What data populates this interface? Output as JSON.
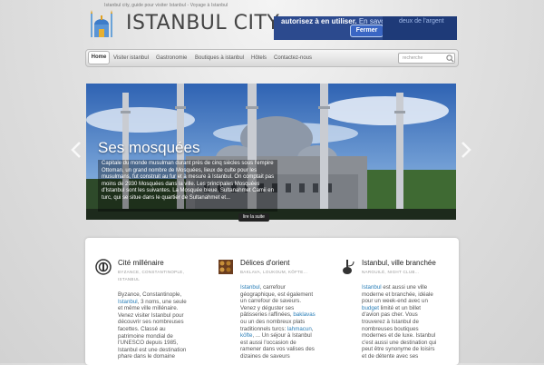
{
  "header": {
    "tagline": "Istanbul city, guide pour visiter Istanbul - Voyage à Istanbul",
    "logo_text": "ISTANBUL CITY"
  },
  "cookie_banner": {
    "text": "autorisez à en utiliser.",
    "more_label": "En savoir plus.",
    "close_label": "Fermer",
    "side_text": "deux de l'argent"
  },
  "nav": {
    "items": [
      "Home",
      "Visiter istanbul",
      "Gastronomie",
      "Boutiques à istanbul",
      "Hôtels",
      "Contactez-nous"
    ],
    "search_placeholder": "recherche"
  },
  "slider": {
    "title": "Ses mosquées",
    "text": "Capitale du monde musulman durant près de cinq siècles sous l'empire Ottoman, un grand nombre de Mosquées, lieux de culte pour les musulmans, fut construit au fur et à mesure à Istanbul. On comptait pas moins de 2930 Mosquées dans la ville. Les principales Mosquées d'Istanbul sont les suivantes. La Mosquée bleue, Sultanahmet Camii en turc, qui se situe dans le quartier de Sultanahmet et...",
    "more_label": "lire la suite"
  },
  "columns": [
    {
      "title": "Cité millénaire",
      "sub": "BYZANCE, CONSTANTINOPLE, ISTANBUL",
      "text_parts": [
        {
          "t": "Byzance, Constantinople, "
        },
        {
          "t": "Istanbul",
          "link": true
        },
        {
          "t": ", 3 noms, une seule et même ville millénaire. Venez visiter Istanbul pour découvrir ses nombreuses facettes. Classé au patrimoine mondial de l'UNESCO depuis 1985, Istanbul est une destination phare dans le domaine"
        }
      ]
    },
    {
      "title": "Délices d'orient",
      "sub": "BAKLAVA, LOUKOUM, KÖFTE...",
      "text_parts": [
        {
          "t": "Istanbul",
          "link": true
        },
        {
          "t": ", carrefour géographique, est également un carrefour de saveurs. Venez y déguster ses pâtisseries raffinées, "
        },
        {
          "t": "baklavas",
          "link": true
        },
        {
          "t": " ou un des nombreux plats traditionnels turcs: "
        },
        {
          "t": "lahmacun",
          "link": true
        },
        {
          "t": ", "
        },
        {
          "t": "köfte",
          "link": true
        },
        {
          "t": ", ... Un séjour à Istanbul est aussi l'occasion de ramener dans vos valises des dizaines de saveurs"
        }
      ]
    },
    {
      "title": "Istanbul, ville branchée",
      "sub": "NARGUILÉ, NIGHT CLUB...",
      "text_parts": [
        {
          "t": "Istanbul",
          "link": true
        },
        {
          "t": " est aussi une ville moderne et branchée, idéale pour un week-end avec un "
        },
        {
          "t": "budget",
          "link": true
        },
        {
          "t": " limité et un billet d'avion pas cher. Vous trouverez à Istanbul de nombreuses boutiques modernes et de luxe. Istanbul c'est aussi une destination qui peut être synonyme de loisirs et de détente avec ses"
        }
      ]
    }
  ],
  "colors": {
    "accent_blue": "#2c4a8e",
    "link": "#2b7fb8"
  }
}
